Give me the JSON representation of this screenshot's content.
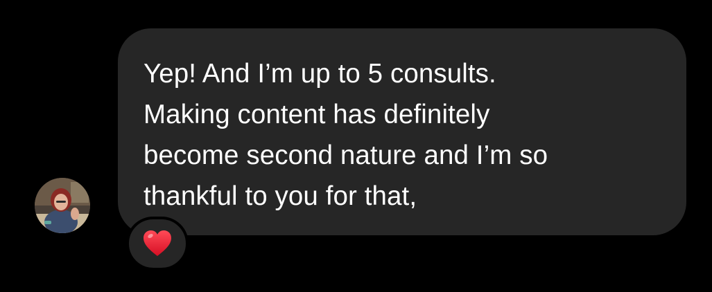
{
  "message": {
    "text": "Yep! And I’m up to 5 consults.\nMaking content has definitely\nbecome second nature and I’m so\nthankful to you for that,",
    "reaction": "heart",
    "reaction_color": "#e0162b"
  },
  "colors": {
    "background": "#000000",
    "bubble": "#262626",
    "text": "#ffffff"
  }
}
